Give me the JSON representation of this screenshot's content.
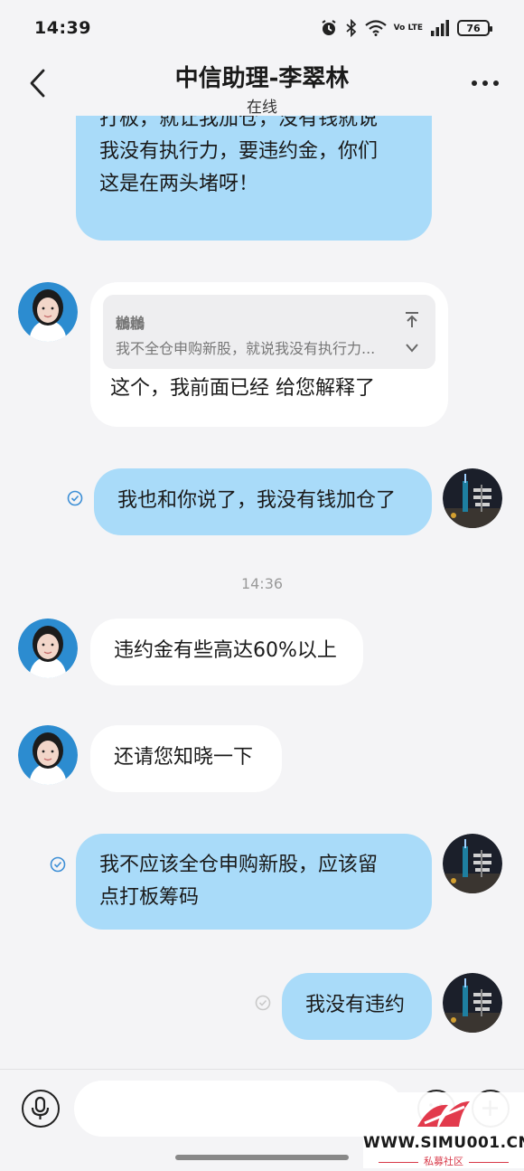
{
  "status_bar": {
    "time": "14:39",
    "battery": "76",
    "network_label": "Vo LTE"
  },
  "header": {
    "title": "中信助理-李翠林",
    "subtitle": "在线"
  },
  "messages": [
    {
      "sender": "me",
      "lines": [
        "打板，就让我加仓，没有钱就说",
        "我没有执行力，要违约金，你们",
        "这是在两头堵呀！"
      ]
    },
    {
      "sender": "them",
      "quote": {
        "name": "鶒鶒",
        "text": "我不全仓申购新股，就说我没有执行力..."
      },
      "text": "这个，我前面已经 给您解释了"
    },
    {
      "sender": "me",
      "text": "我也和你说了，我没有钱加仓了",
      "read": true
    },
    {
      "timestamp": "14:36"
    },
    {
      "sender": "them",
      "text": "违约金有些高达60%以上"
    },
    {
      "sender": "them",
      "text": "还请您知晓一下"
    },
    {
      "sender": "me",
      "lines": [
        "我不应该全仓申购新股，应该留",
        "点打板筹码"
      ],
      "read": true
    },
    {
      "sender": "me",
      "text": "我没有违约",
      "read": false
    }
  ],
  "watermark": {
    "url": "WWW.SIMU001.CN",
    "subtitle": "私募社区"
  },
  "colors": {
    "my_bubble": "#a9dbf9",
    "their_bubble": "#ffffff",
    "background": "#f4f4f6",
    "read_check": "#3d8fd6"
  }
}
